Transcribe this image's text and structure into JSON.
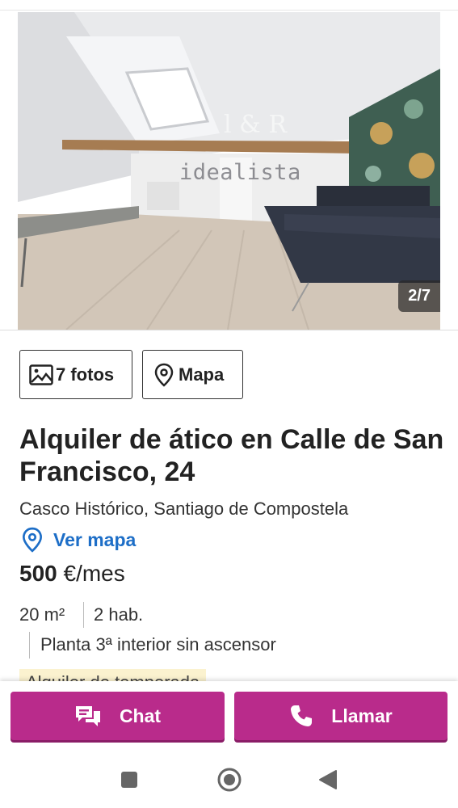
{
  "gallery": {
    "counter": "2/7",
    "watermark": "idealista",
    "agency_watermark": "l & R"
  },
  "actions": {
    "photos_label": "7 fotos",
    "map_label": "Mapa"
  },
  "listing": {
    "title": "Alquiler de ático en Calle de San Francisco, 24",
    "location": "Casco Histórico, Santiago de Compostela",
    "map_link": "Ver mapa",
    "price_value": "500",
    "price_unit": "€/mes",
    "features": {
      "area": "20 m²",
      "rooms": "2 hab.",
      "floor": "Planta 3ª interior sin ascensor"
    },
    "tag": "Alquiler de temporada"
  },
  "contact": {
    "chat_label": "Chat",
    "call_label": "Llamar"
  },
  "colors": {
    "accent": "#b92b8b",
    "link": "#1d6ec7",
    "tag_bg": "#fbf2cf"
  },
  "icons": {
    "photos": "image-icon",
    "map": "map-pin-icon",
    "chat": "chat-bubbles-icon",
    "call": "phone-icon"
  }
}
